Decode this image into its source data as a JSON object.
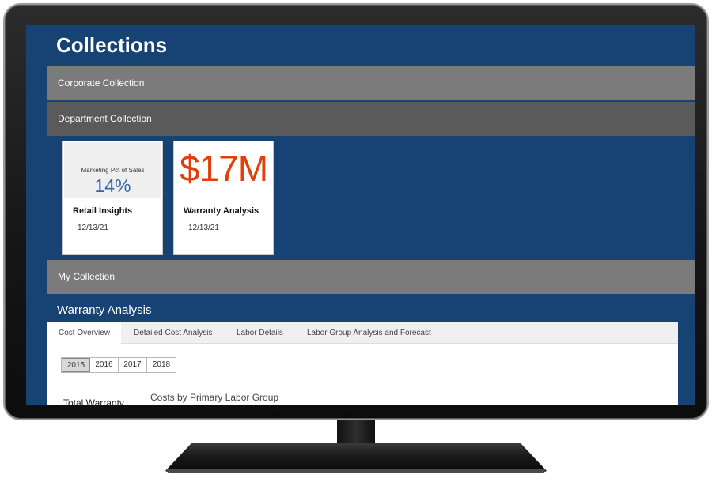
{
  "header": {
    "title": "Collections"
  },
  "sections": {
    "corporate": {
      "label": "Corporate Collection"
    },
    "department": {
      "label": "Department Collection"
    },
    "my": {
      "label": "My Collection"
    }
  },
  "cards": [
    {
      "thumb_label": "Marketing Pct of Sales",
      "thumb_value": "14%",
      "title": "Retail Insights",
      "date": "12/13/21"
    },
    {
      "thumb_value": "$17M",
      "title": "Warranty Analysis",
      "date": "12/13/21"
    }
  ],
  "report": {
    "title": "Warranty Analysis",
    "tabs": [
      {
        "label": "Cost Overview",
        "active": true
      },
      {
        "label": "Detailed Cost Analysis"
      },
      {
        "label": "Labor Details"
      },
      {
        "label": "Labor Group Analysis and Forecast"
      }
    ],
    "years": [
      "2015",
      "2016",
      "2017",
      "2018"
    ],
    "selected_year": "2015",
    "total_label": "Total Warranty",
    "chart_title": "Costs by Primary Labor Group"
  },
  "colors": {
    "screen_bg": "#164274",
    "bar_light": "#7b7b7b",
    "bar_dark": "#5a5a5a",
    "accent_value": "#e0400a",
    "kpi_blue": "#2e6ba6"
  }
}
